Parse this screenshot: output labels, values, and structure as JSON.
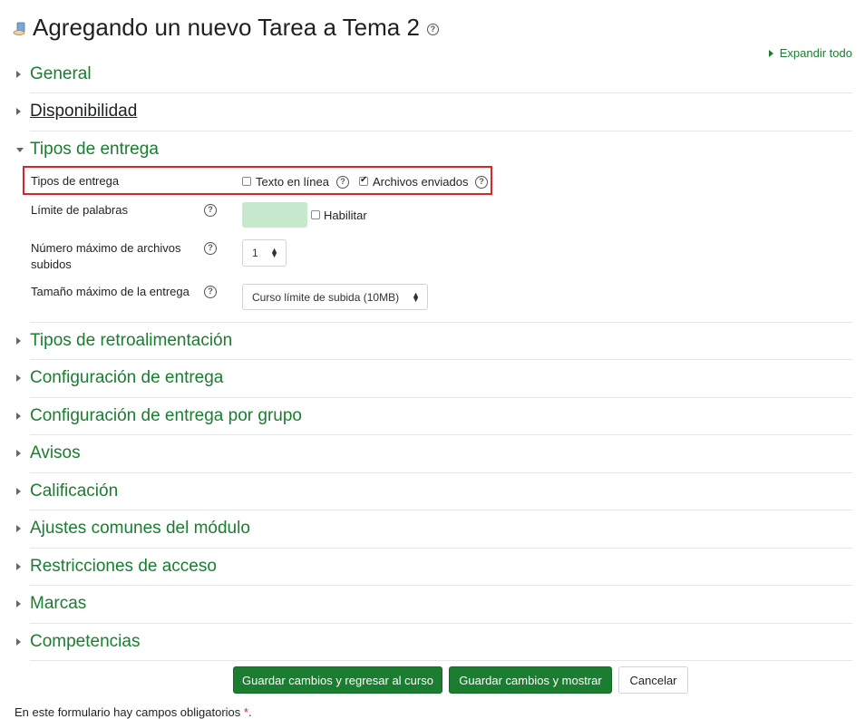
{
  "page": {
    "title": "Agregando un nuevo Tarea a Tema 2",
    "expand_all": "Expandir todo"
  },
  "sections": {
    "general": "General",
    "disponibilidad": "Disponibilidad",
    "tipos_entrega": "Tipos de entrega",
    "retroalimentacion": "Tipos de retroalimentación",
    "config_entrega": "Configuración de entrega",
    "config_grupo": "Configuración de entrega por grupo",
    "avisos": "Avisos",
    "calificacion": "Calificación",
    "ajustes_modulo": "Ajustes comunes del módulo",
    "restricciones": "Restricciones de acceso",
    "marcas": "Marcas",
    "competencias": "Competencias"
  },
  "form": {
    "tipos_label": "Tipos de entrega",
    "texto_en_linea": "Texto en línea",
    "archivos_enviados": "Archivos enviados",
    "limite_palabras_label": "Límite de palabras",
    "habilitar": "Habilitar",
    "max_archivos_label_1": "Número máximo de archivos",
    "max_archivos_label_2": "subidos",
    "max_archivos_value": "1",
    "tamano_label": "Tamaño máximo de la entrega",
    "tamano_value": "Curso límite de subida (10MB)",
    "texto_en_linea_checked": false,
    "archivos_enviados_checked": true,
    "habilitar_checked": false
  },
  "buttons": {
    "save_return": "Guardar cambios y regresar al curso",
    "save_show": "Guardar cambios y mostrar",
    "cancel": "Cancelar"
  },
  "footer": {
    "required_note": "En este formulario hay campos obligatorios",
    "required_star": "*",
    "required_period": "."
  },
  "colors": {
    "accent": "#1a7d30",
    "highlight_border": "#d9262b",
    "input_fill": "#c6e8cc"
  }
}
